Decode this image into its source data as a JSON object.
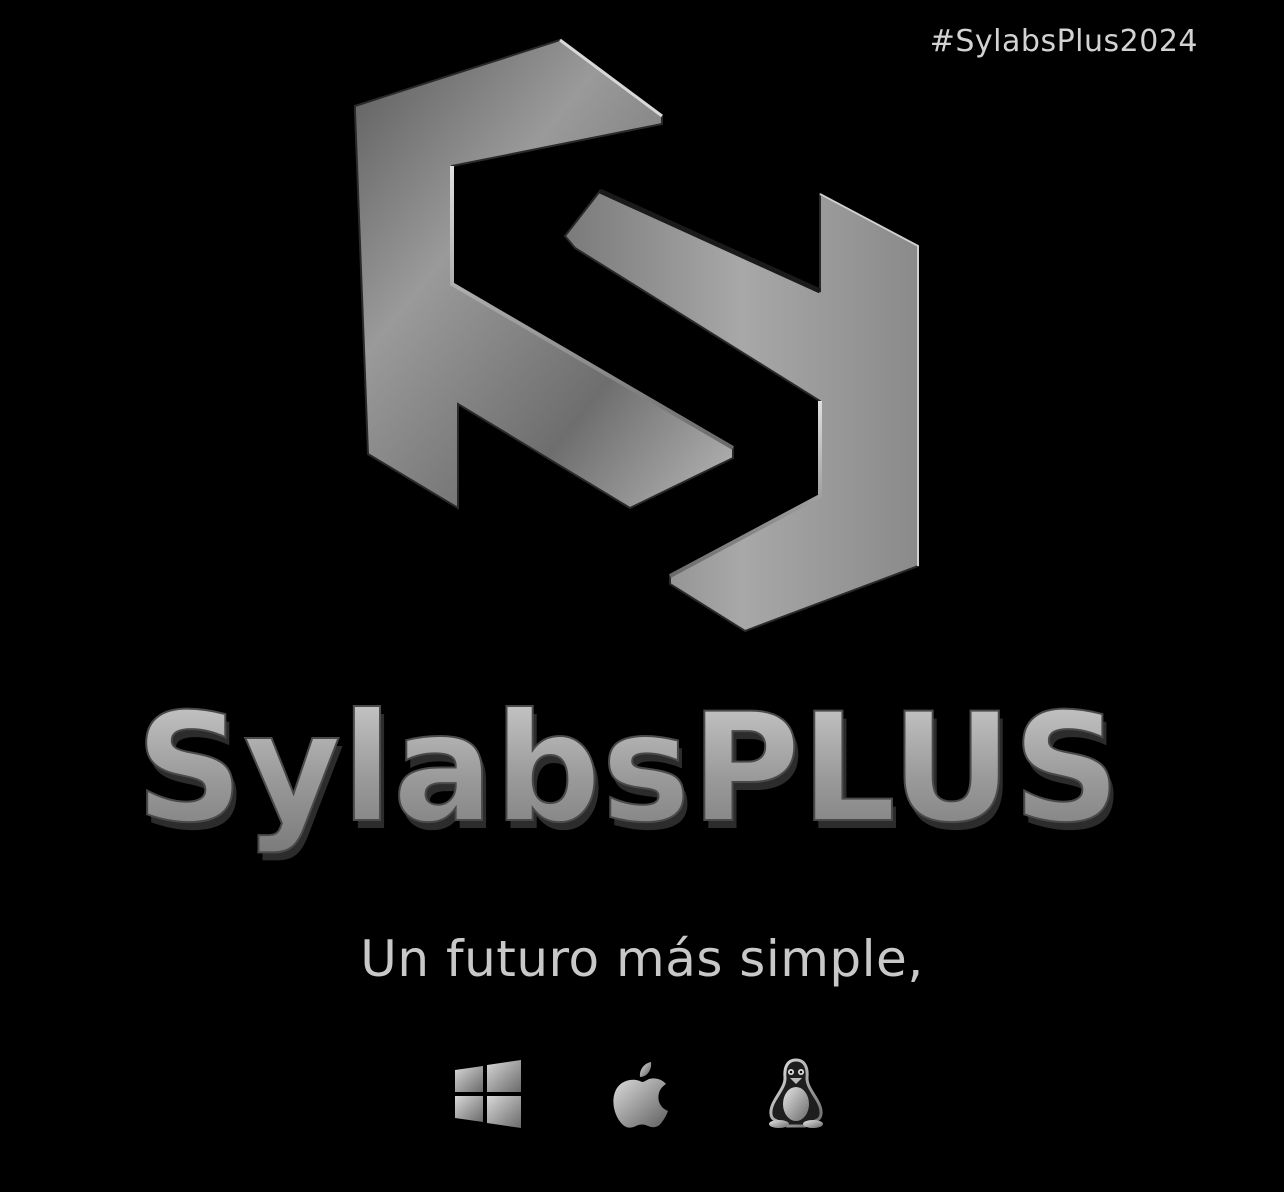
{
  "hashtag": "#SylabsPlus2024",
  "brand": {
    "name_part1": "Sylabs",
    "name_part2": "PLUS"
  },
  "tagline": "Un futuro más simple,",
  "platforms": [
    {
      "name": "windows",
      "icon": "windows-icon"
    },
    {
      "name": "apple",
      "icon": "apple-icon"
    },
    {
      "name": "linux",
      "icon": "linux-tux-icon"
    }
  ],
  "colors": {
    "background": "#000000",
    "metal_light": "#cfcfcf",
    "metal_mid": "#8a8a8a",
    "metal_dark": "#3a3a3a",
    "text": "#c8c8c8"
  }
}
